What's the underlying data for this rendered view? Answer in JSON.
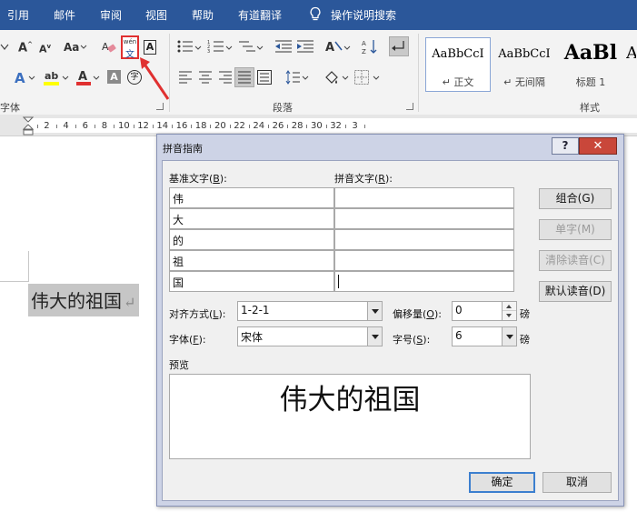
{
  "ribbon_tabs": [
    "引用",
    "邮件",
    "审阅",
    "视图",
    "帮助",
    "有道翻译"
  ],
  "tell_me": "操作说明搜索",
  "groups": {
    "font": "字体",
    "paragraph": "段落",
    "styles": "样式"
  },
  "phonetic_icon": {
    "top": "wén",
    "bottom": "文"
  },
  "styles": [
    {
      "sample": "AaBbCcI",
      "name": "↵ 正文"
    },
    {
      "sample": "AaBbCcI",
      "name": "↵ 无间隔"
    },
    {
      "sample": "AaBl",
      "name": "标题 1"
    },
    {
      "sample": "A",
      "name": ""
    }
  ],
  "ruler_numbers": [
    "2",
    "4",
    "6",
    "8",
    "10",
    "12",
    "14",
    "16",
    "18",
    "20",
    "22",
    "24",
    "26",
    "28",
    "30",
    "32",
    "3"
  ],
  "document": {
    "text": "伟大的祖国",
    "para_mark": "↵"
  },
  "dialog": {
    "title": "拼音指南",
    "help": "?",
    "close": "✕",
    "base_label": "基准文字",
    "base_key": "B",
    "ruby_label": "拼音文字",
    "ruby_key": "R",
    "rows": [
      {
        "base": "伟",
        "ruby": ""
      },
      {
        "base": "大",
        "ruby": ""
      },
      {
        "base": "的",
        "ruby": ""
      },
      {
        "base": "祖",
        "ruby": ""
      },
      {
        "base": "国",
        "ruby": ""
      }
    ],
    "buttons": {
      "group": "组合(G)",
      "mono": "单字(M)",
      "clear": "清除读音(C)",
      "default_reading": "默认读音(D)",
      "ok": "确定",
      "cancel": "取消"
    },
    "align_label": "对齐方式",
    "align_key": "L",
    "align_value": "1-2-1",
    "offset_label": "偏移量",
    "offset_key": "O",
    "offset_value": "0",
    "offset_unit": "磅",
    "font_label": "字体",
    "font_key": "F",
    "font_value": "宋体",
    "size_label": "字号",
    "size_key": "S",
    "size_value": "6",
    "size_unit": "磅",
    "preview_label": "预览",
    "preview_text": "伟大的祖国"
  },
  "colors": {
    "ribbon_blue": "#2b579a",
    "highlight_red": "#e03030",
    "selection_gray": "#c6c6c6",
    "dialog_accent": "#3c7fcf"
  }
}
